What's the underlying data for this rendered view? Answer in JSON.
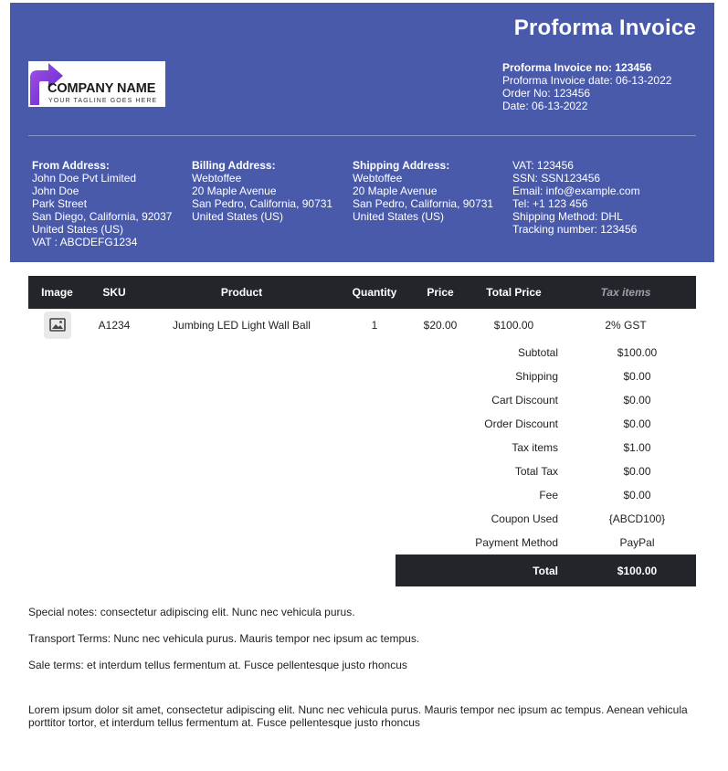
{
  "header": {
    "title": "Proforma Invoice",
    "logo": {
      "name": "COMPANY NAME",
      "tagline": "YOUR TAGLINE GOES HERE"
    },
    "meta": {
      "invoice_no": "Proforma Invoice no: 123456",
      "invoice_date": "Proforma Invoice date: 06-13-2022",
      "order_no": "Order No: 123456",
      "date": "Date: 06-13-2022"
    },
    "from": {
      "heading": "From Address:",
      "lines": [
        "John Doe Pvt Limited",
        "John Doe",
        "Park Street",
        "San Diego, California, 92037",
        "United States (US)",
        "VAT : ABCDEFG1234"
      ]
    },
    "billing": {
      "heading": "Billing Address:",
      "lines": [
        "Webtoffee",
        "20 Maple Avenue",
        "San Pedro, California, 90731",
        "United States (US)"
      ]
    },
    "shipping": {
      "heading": "Shipping Address:",
      "lines": [
        "Webtoffee",
        "20 Maple Avenue",
        "San Pedro, California, 90731",
        "United States (US)"
      ]
    },
    "extra": {
      "lines": [
        "VAT: 123456",
        "SSN: SSN123456",
        "Email: info@example.com",
        "Tel: +1 123 456",
        "Shipping Method: DHL",
        "Tracking number: 123456"
      ]
    }
  },
  "table": {
    "columns": [
      "Image",
      "SKU",
      "Product",
      "Quantity",
      "Price",
      "Total Price",
      "Tax items"
    ],
    "rows": [
      {
        "sku": "A1234",
        "product": "Jumbing LED Light Wall Ball",
        "quantity": "1",
        "price": "$20.00",
        "total": "$100.00",
        "tax": "2% GST"
      }
    ]
  },
  "totals": [
    {
      "label": "Subtotal",
      "value": "$100.00"
    },
    {
      "label": "Shipping",
      "value": "$0.00"
    },
    {
      "label": "Cart Discount",
      "value": "$0.00"
    },
    {
      "label": "Order Discount",
      "value": "$0.00"
    },
    {
      "label": "Tax items",
      "value": "$1.00"
    },
    {
      "label": "Total Tax",
      "value": "$0.00"
    },
    {
      "label": "Fee",
      "value": "$0.00"
    },
    {
      "label": "Coupon Used",
      "value": "{ABCD100}"
    },
    {
      "label": "Payment Method",
      "value": "PayPal"
    }
  ],
  "grand_total": {
    "label": "Total",
    "value": "$100.00"
  },
  "notes": {
    "special": "Special notes: consectetur adipiscing elit. Nunc nec vehicula purus.",
    "transport": "Transport Terms: Nunc nec vehicula purus. Mauris tempor nec ipsum ac tempus.",
    "sale": "Sale terms: et interdum tellus fermentum at. Fusce pellentesque justo rhoncus",
    "footer": "Lorem ipsum dolor sit amet, consectetur adipiscing elit. Nunc nec vehicula purus. Mauris tempor nec ipsum ac tempus. Aenean vehicula porttitor tortor, et interdum tellus fermentum at. Fusce pellentesque justo rhoncus"
  },
  "colors": {
    "header_bg": "#4a5aab",
    "table_header_bg": "#23252a",
    "logo_accent": "#7b3fd6"
  }
}
